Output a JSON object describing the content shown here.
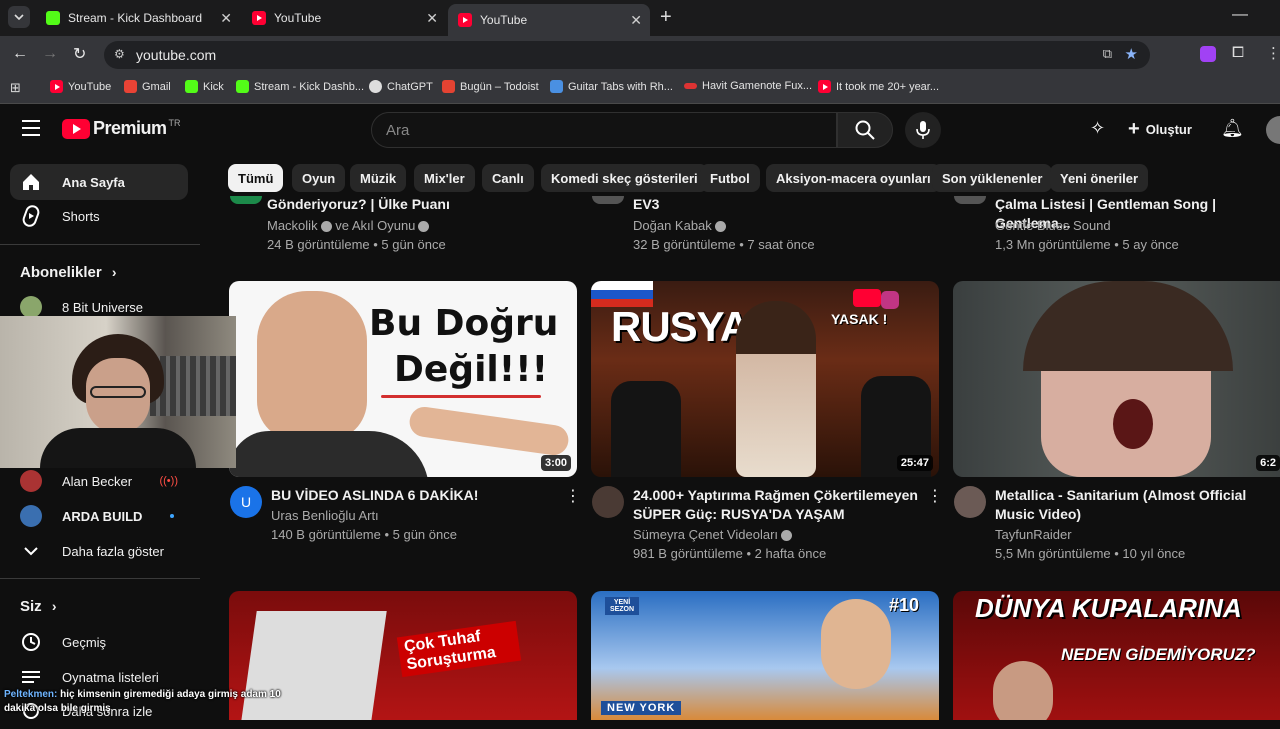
{
  "browser": {
    "tabs": [
      {
        "label": "Stream - Kick Dashboard",
        "favicon": "kick-icon"
      },
      {
        "label": "YouTube",
        "favicon": "youtube-icon"
      },
      {
        "label": "YouTube",
        "favicon": "youtube-icon",
        "active": true
      }
    ],
    "url": "youtube.com",
    "bookmarks": [
      "YouTube",
      "Gmail",
      "Kick",
      "Stream - Kick Dashb...",
      "ChatGPT",
      "Bugün – Todoist",
      "Guitar Tabs with Rh...",
      "Havit Gamenote Fux...",
      "It took me 20+ year..."
    ]
  },
  "header": {
    "logo": "Premium",
    "region": "TR",
    "search_placeholder": "Ara",
    "create_label": "Oluştur"
  },
  "chips": [
    "Tümü",
    "Oyun",
    "Müzik",
    "Mix'ler",
    "Canlı",
    "Komedi skeç gösterileri",
    "Futbol",
    "Aksiyon-macera oyunları",
    "Son yüklenenler",
    "Yeni öneriler"
  ],
  "sidebar": {
    "home": "Ana Sayfa",
    "shorts": "Shorts",
    "subscriptions_header": "Abonelikler",
    "subs": [
      {
        "name": "8 Bit Universe"
      },
      {
        "name": "Alan Becker",
        "live": true
      },
      {
        "name": "ARDA BUILD",
        "new": true
      }
    ],
    "show_more": "Daha fazla göster",
    "you_header": "Siz",
    "history": "Geçmiş",
    "playlists": "Oynatma listeleri",
    "watch_later": "Daha sonra izle"
  },
  "top_row": [
    {
      "title": "Gönderiyoruz? | Ülke Puanı",
      "channel": "Mackolik",
      "channel2": "ve Akıl Oyunu",
      "meta": "24 B görüntüleme • 5 gün önce"
    },
    {
      "title": "EV3",
      "channel": "Doğan Kabak",
      "meta": "32 B görüntüleme • 7 saat önce"
    },
    {
      "title": "Çalma Listesi | Gentleman Song | Gentlema...",
      "channel": "Gentle Blues Sound",
      "meta": "1,3 Mn görüntüleme • 5 ay önce"
    }
  ],
  "videos": [
    {
      "title": "BU VİDEO ASLINDA 6 DAKİKA!",
      "channel": "Uras Benlioğlu Artı",
      "meta": "140 B görüntüleme • 5 gün önce",
      "duration": "3:00",
      "thumb_text_1": "Bu Doğru",
      "thumb_text_2": "Değil!!!",
      "avatar_letter": "U"
    },
    {
      "title": "24.000+ Yaptırıma Rağmen Çökertilemeyen SÜPER Güç: RUSYA'DA YAŞAM",
      "channel": "Sümeyra Çenet Videoları",
      "meta": "981 B görüntüleme • 2 hafta önce",
      "duration": "25:47",
      "thumb_text_1": "RUSYA",
      "thumb_text_2": "YASAK !"
    },
    {
      "title": "Metallica - Sanitarium (Almost Official Music Video)",
      "channel": "TayfunRaider",
      "meta": "5,5 Mn görüntüleme • 10 yıl önce",
      "duration": "6:2"
    }
  ],
  "bottom_row": [
    {
      "thumb_text": "Çok Tuhaf Soruşturma"
    },
    {
      "thumb_text_1": "#10",
      "thumb_text_2": "NEW YORK",
      "thumb_text_3": "YENİ SEZON"
    },
    {
      "thumb_text_1": "DÜNYA KUPALARINA",
      "thumb_text_2": "NEDEN GİDEMİYORUZ?"
    }
  ],
  "chat": {
    "user": "Peltekmen:",
    "message": "hiç kimsenin giremediği adaya girmiş adam 10 dakika olsa bile girmiş"
  },
  "colors": {
    "accent": "#ff0033",
    "kick": "#53fc18",
    "bg": "#0f0f0f"
  }
}
